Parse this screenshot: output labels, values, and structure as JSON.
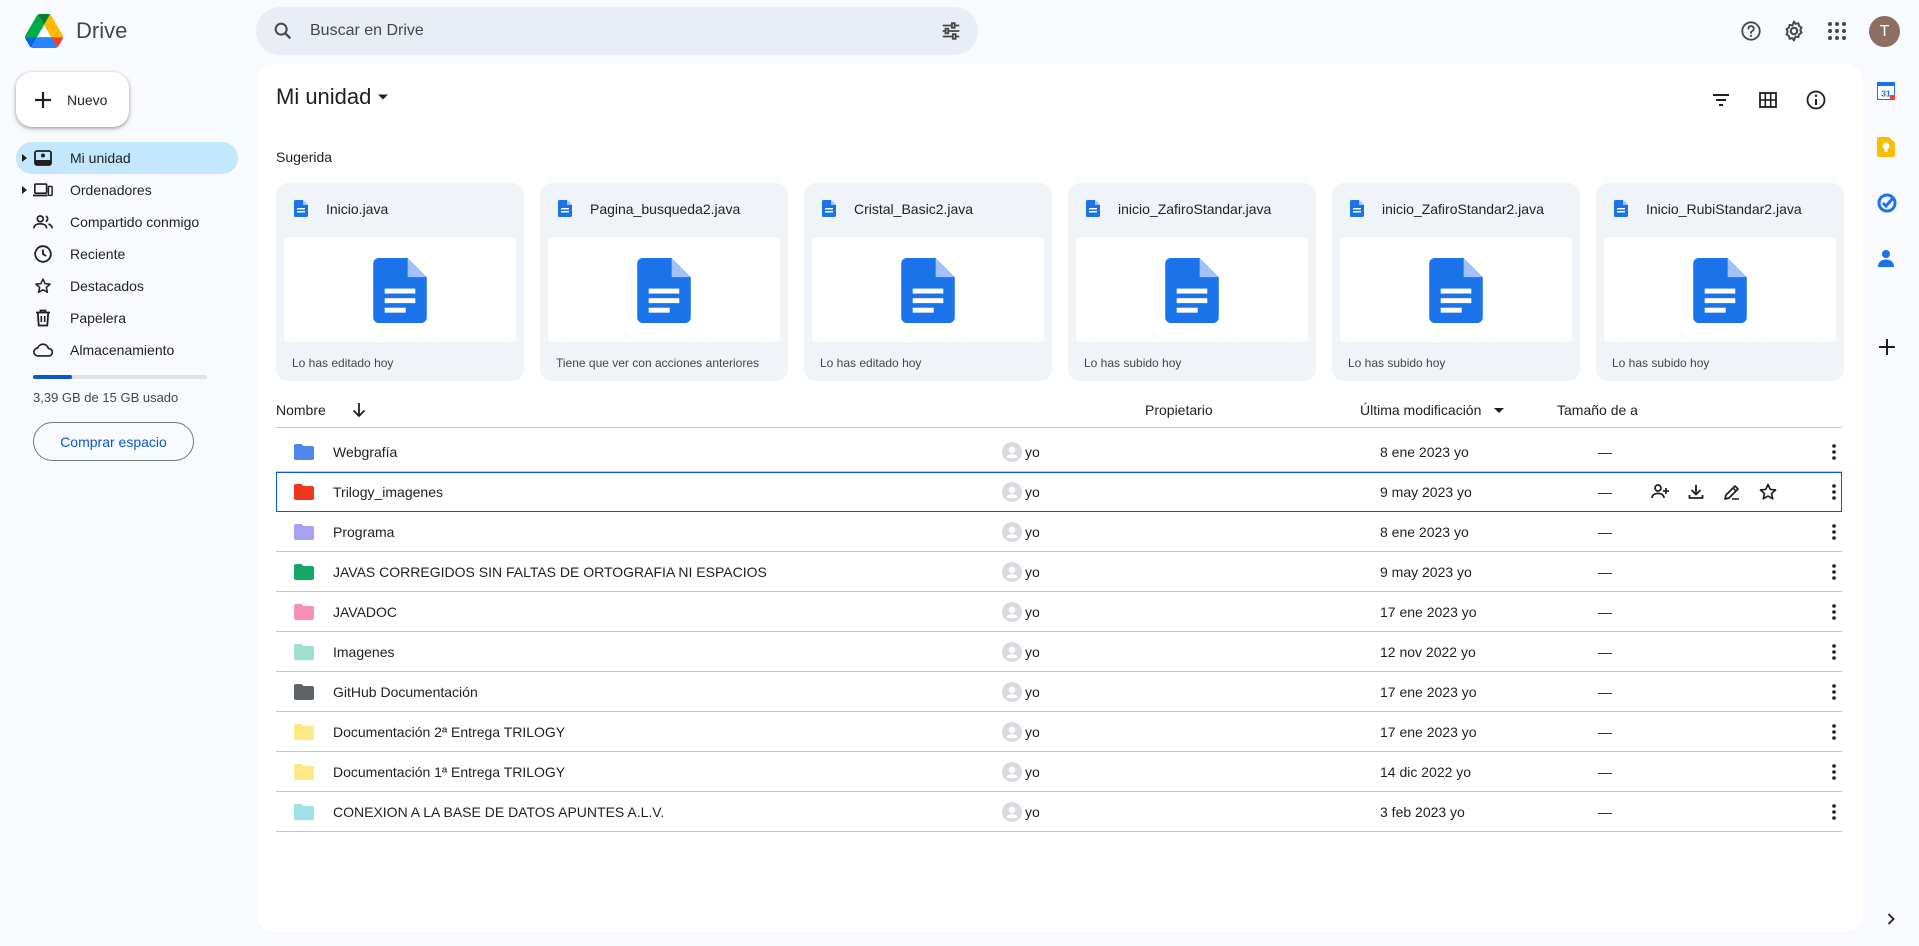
{
  "app": {
    "name": "Drive"
  },
  "search": {
    "placeholder": "Buscar en Drive"
  },
  "new_button": {
    "label": "Nuevo"
  },
  "sidebar": {
    "items": [
      {
        "label": "Mi unidad",
        "icon": "my-drive-icon",
        "active": true
      },
      {
        "label": "Ordenadores",
        "icon": "computers-icon"
      },
      {
        "label": "Compartido conmigo",
        "icon": "shared-icon"
      },
      {
        "label": "Reciente",
        "icon": "clock-icon"
      },
      {
        "label": "Destacados",
        "icon": "star-icon"
      },
      {
        "label": "Papelera",
        "icon": "trash-icon"
      },
      {
        "label": "Almacenamiento",
        "icon": "cloud-icon"
      }
    ],
    "storage": {
      "used_fraction": 0.226,
      "text": "3,39 GB de 15 GB usado"
    },
    "buy_label": "Comprar espacio"
  },
  "main": {
    "title": "Mi unidad",
    "suggested_label": "Sugerida",
    "suggested": [
      {
        "name": "Inicio.java",
        "reason": "Lo has editado hoy"
      },
      {
        "name": "Pagina_busqueda2.java",
        "reason": "Tiene que ver con acciones anteriores"
      },
      {
        "name": "Cristal_Basic2.java",
        "reason": "Lo has editado hoy"
      },
      {
        "name": "inicio_ZafiroStandar.java",
        "reason": "Lo has subido hoy"
      },
      {
        "name": "inicio_ZafiroStandar2.java",
        "reason": "Lo has subido hoy"
      },
      {
        "name": "Inicio_RubiStandar2.java",
        "reason": "Lo has subido hoy"
      }
    ],
    "columns": {
      "name": "Nombre",
      "owner": "Propietario",
      "modified": "Última modificación",
      "size": "Tamaño de a"
    },
    "files": [
      {
        "name": "Webgrafía",
        "color": "#4f86ec",
        "owner": "yo",
        "modified": "8 ene 2023 yo",
        "size": "—"
      },
      {
        "name": "Trilogy_imagenes",
        "color": "#f0361c",
        "owner": "yo",
        "modified": "9 may 2023 yo",
        "size": "—",
        "selected": true
      },
      {
        "name": "Programa",
        "color": "#a8a2f5",
        "owner": "yo",
        "modified": "8 ene 2023 yo",
        "size": "—"
      },
      {
        "name": "JAVAS CORREGIDOS SIN FALTAS DE ORTOGRAFIA NI ESPACIOS",
        "color": "#16a765",
        "owner": "yo",
        "modified": "9 may 2023 yo",
        "size": "—"
      },
      {
        "name": "JAVADOC",
        "color": "#f691b2",
        "owner": "yo",
        "modified": "17 ene 2023 yo",
        "size": "—"
      },
      {
        "name": "Imagenes",
        "color": "#9fe1c9",
        "owner": "yo",
        "modified": "12 nov 2022 yo",
        "size": "—"
      },
      {
        "name": "GitHub Documentación",
        "color": "#5f6368",
        "owner": "yo",
        "modified": "17 ene 2023 yo",
        "size": "—"
      },
      {
        "name": "Documentación 2ª Entrega TRILOGY",
        "color": "#fbe983",
        "owner": "yo",
        "modified": "17 ene 2023 yo",
        "size": "—"
      },
      {
        "name": "Documentación 1ª Entrega TRILOGY",
        "color": "#fbe983",
        "owner": "yo",
        "modified": "14 dic 2022 yo",
        "size": "—"
      },
      {
        "name": "CONEXION A LA BASE DE DATOS APUNTES A.L.V.",
        "color": "#9fe1e7",
        "owner": "yo",
        "modified": "3 feb 2023 yo",
        "size": "—"
      }
    ]
  },
  "user": {
    "initial": "T"
  },
  "colors": {
    "accent": "#0b57d0",
    "doc_blue": "#1a73e8",
    "active_nav": "#c2e7ff"
  }
}
